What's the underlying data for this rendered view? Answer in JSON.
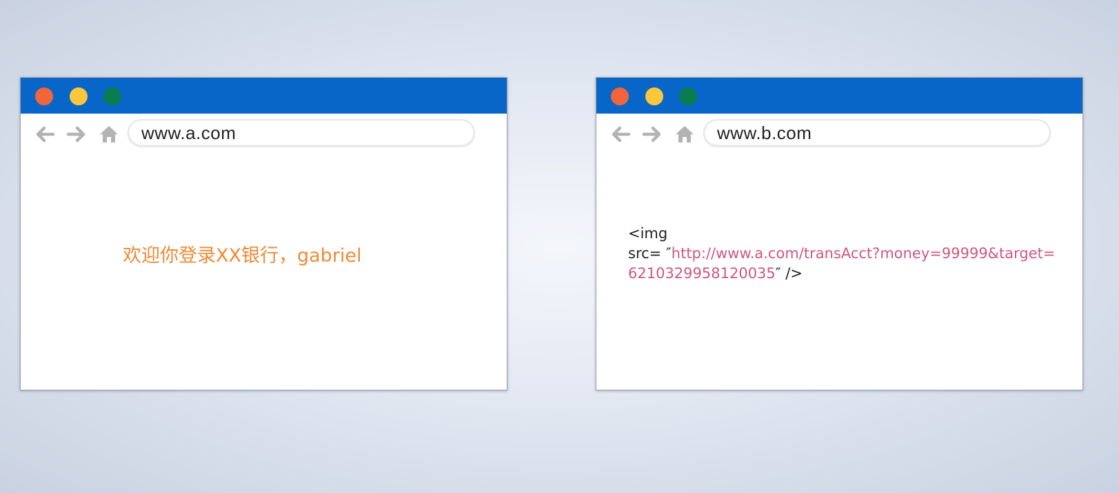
{
  "colors": {
    "titlebar": "#0866c9",
    "dot_red": "#f0663a",
    "dot_yellow": "#fcc73a",
    "dot_green": "#0b7c4d",
    "nav_icon": "#b3b3b3",
    "welcome_text": "#ee8a33",
    "code_url": "#d0577e"
  },
  "icons": {
    "back": "arrow-left-icon",
    "forward": "arrow-right-icon",
    "home": "home-icon"
  },
  "browser_a": {
    "url": "www.a.com",
    "welcome": "欢迎你登录XX银行，gabriel"
  },
  "browser_b": {
    "url": "www.b.com",
    "code_line1": "<img",
    "code_prefix": "src= ″",
    "code_url": "http://www.a.com/transAcct?money=99999&target=6210329958120035",
    "code_suffix": "″ />"
  }
}
